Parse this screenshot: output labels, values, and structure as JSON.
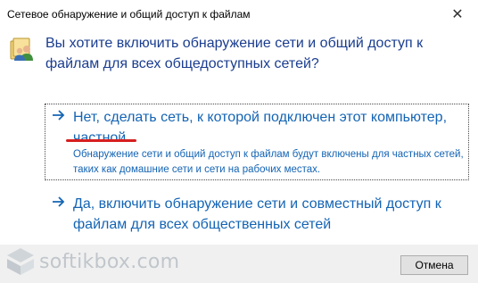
{
  "window": {
    "title": "Сетевое обнаружение и общий доступ к файлам",
    "close_glyph": "✕"
  },
  "prompt": {
    "question": "Вы хотите включить обнаружение сети и общий доступ к файлам для всех общедоступных сетей?",
    "icon": "network-users-icon"
  },
  "options": [
    {
      "arrow_icon": "arrow-right-icon",
      "title": "Нет, сделать сеть, к которой подключен этот компьютер, частной",
      "description": "Обнаружение сети и общий доступ к файлам будут включены для частных сетей, таких как домашние сети и сети на рабочих местах.",
      "selected": true
    },
    {
      "arrow_icon": "arrow-right-icon",
      "title": "Да, включить обнаружение сети и совместный доступ к файлам для всех общественных сетей",
      "description": "",
      "selected": false
    }
  ],
  "footer": {
    "cancel_label": "Отмена"
  },
  "watermark": {
    "text": "softikbox.com"
  },
  "colors": {
    "question": "#1a3d8f",
    "link": "#1464b4",
    "annotation": "#d61f1f",
    "footer_bg": "#f0f0f0"
  }
}
